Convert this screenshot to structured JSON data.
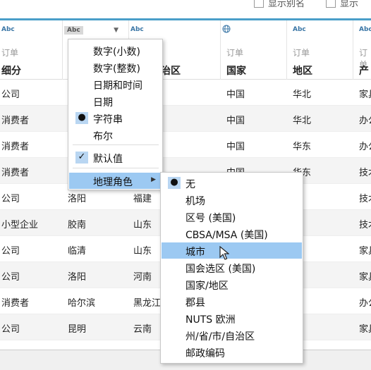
{
  "top_options": [
    "显示别名",
    "显示"
  ],
  "columns": [
    {
      "type": "Abc",
      "source": "订单",
      "name": "细分"
    },
    {
      "type": "Abc",
      "source": "",
      "name": ""
    },
    {
      "type": "Abc",
      "source": "",
      "name": "治区"
    },
    {
      "type": "globe",
      "source": "订单",
      "name": "国家"
    },
    {
      "type": "Abc",
      "source": "订单",
      "name": "地区"
    },
    {
      "type": "Abc",
      "source": "订单",
      "name": "产品"
    }
  ],
  "rows": [
    [
      "公司",
      "",
      "",
      "中国",
      "华北",
      "家具"
    ],
    [
      "消费者",
      "",
      "",
      "中国",
      "华北",
      "办公用品"
    ],
    [
      "消费者",
      "",
      "",
      "中国",
      "华东",
      "办公用品"
    ],
    [
      "消费者",
      "",
      "",
      "中国",
      "华东",
      "技术"
    ],
    [
      "公司",
      "洛阳",
      "福建",
      "",
      "东",
      "技术"
    ],
    [
      "小型企业",
      "胶南",
      "山东",
      "",
      "东",
      "技术"
    ],
    [
      "公司",
      "临清",
      "山东",
      "",
      "东",
      "家具"
    ],
    [
      "公司",
      "洛阳",
      "河南",
      "",
      "南",
      "家具"
    ],
    [
      "消费者",
      "哈尔滨",
      "黑龙江",
      "",
      "北",
      "办公用品"
    ],
    [
      "公司",
      "昆明",
      "云南",
      "",
      "南",
      "家具"
    ]
  ],
  "type_menu": {
    "items": [
      {
        "label": "数字(小数)",
        "mark": ""
      },
      {
        "label": "数字(整数)",
        "mark": ""
      },
      {
        "label": "日期和时间",
        "mark": ""
      },
      {
        "label": "日期",
        "mark": ""
      },
      {
        "label": "字符串",
        "mark": "●"
      },
      {
        "label": "布尔",
        "mark": ""
      }
    ],
    "default_label": "默认值",
    "default_mark": "✓",
    "geo_label": "地理角色",
    "geo_arrow": "▶"
  },
  "geo_menu": {
    "items": [
      {
        "label": "无",
        "mark": "●"
      },
      {
        "label": "机场",
        "mark": ""
      },
      {
        "label": "区号 (美国)",
        "mark": ""
      },
      {
        "label": "CBSA/MSA (美国)",
        "mark": ""
      },
      {
        "label": "城市",
        "mark": ""
      },
      {
        "label": "国会选区 (美国)",
        "mark": ""
      },
      {
        "label": "国家/地区",
        "mark": ""
      },
      {
        "label": "郡县",
        "mark": ""
      },
      {
        "label": "NUTS 欧洲",
        "mark": ""
      },
      {
        "label": "州/省/市/自治区",
        "mark": ""
      },
      {
        "label": "邮政编码",
        "mark": ""
      }
    ],
    "highlighted_index": 4
  },
  "colors": {
    "accent": "#4a9ec9",
    "highlight": "#9cc9f2",
    "type_blue": "#3a76a6"
  }
}
